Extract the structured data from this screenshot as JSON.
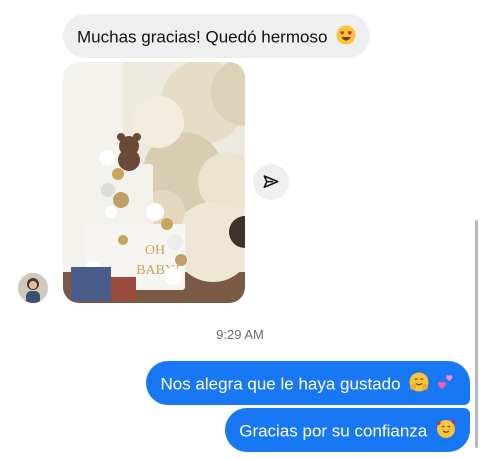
{
  "messages": [
    {
      "direction": "received",
      "text": "Muchas gracias! Quedó hermoso",
      "emoji": "heart-eyes-emoji"
    },
    {
      "direction": "received",
      "type": "photo",
      "cake_topper_text": "OH BABY!"
    },
    {
      "direction": "sent",
      "text": "Nos alegra que le haya gustado",
      "emoji": "hugging-face-and-pink-hearts-emoji"
    },
    {
      "direction": "sent",
      "text": "Gracias por su confianza",
      "emoji": "smiling-face-with-hearts-emoji"
    }
  ],
  "timestamp": "9:29 AM",
  "share_icon": "paper-plane-icon",
  "colors": {
    "sent_bubble": "#1877f2",
    "received_bubble": "#efefef",
    "timestamp_text": "#6b6b6b"
  }
}
